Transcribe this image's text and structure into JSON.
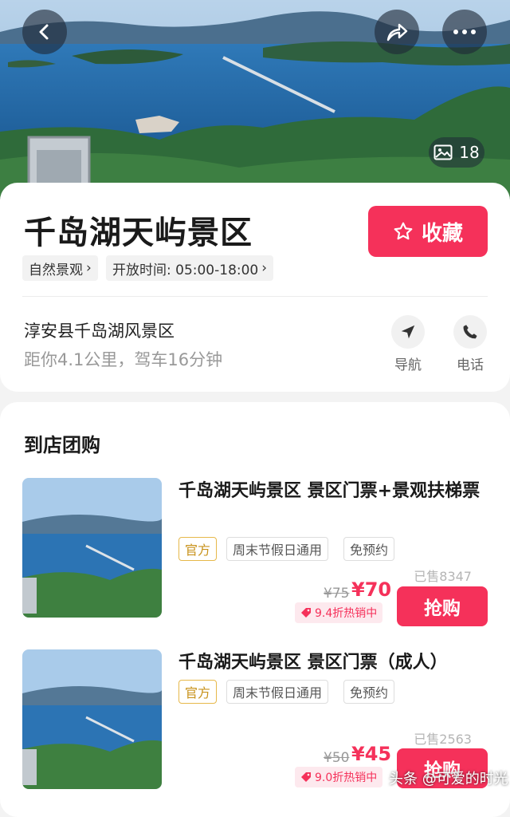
{
  "hero": {
    "photo_count": "18"
  },
  "place": {
    "title": "千岛湖天屿景区",
    "favorite_label": "收藏",
    "category_chip": "自然景观",
    "hours_chip": "开放时间: 05:00-18:00",
    "address": "淳安县千岛湖风景区",
    "distance": "距你4.1公里，驾车16分钟",
    "nav_label": "导航",
    "phone_label": "电话"
  },
  "deals": {
    "section_title": "到店团购",
    "items": [
      {
        "title": "千岛湖天屿景区 景区门票+景观扶梯票",
        "tags": [
          "官方",
          "周末节假日通用",
          "免预约"
        ],
        "sold": "已售8347",
        "original_price": "¥75",
        "price": "¥70",
        "discount": "9.4折热销中",
        "buy_label": "抢购"
      },
      {
        "title": "千岛湖天屿景区 景区门票（成人）",
        "tags": [
          "官方",
          "周末节假日通用",
          "免预约"
        ],
        "sold": "已售2563",
        "original_price": "¥50",
        "price": "¥45",
        "discount": "9.0折热销中",
        "buy_label": "抢购"
      }
    ]
  },
  "watermark": "头条 @可爱的时光",
  "colors": {
    "accent": "#f5315a",
    "official_tag": "#c8921b"
  },
  "icons": [
    "back-icon",
    "share-icon",
    "more-icon",
    "image-icon",
    "star-icon",
    "navigation-icon",
    "phone-icon",
    "tag-icon"
  ]
}
